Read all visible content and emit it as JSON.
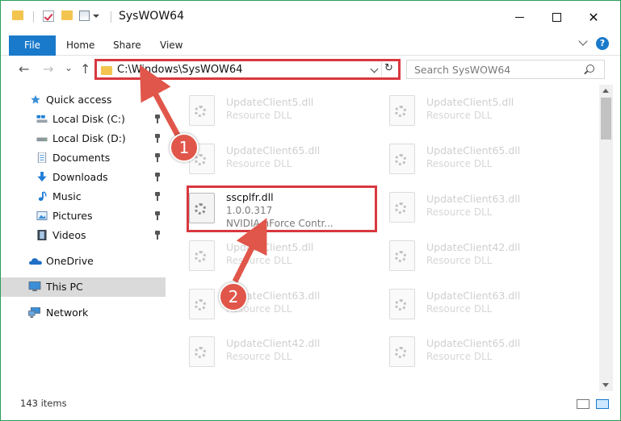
{
  "window": {
    "title": "SysWOW64",
    "controls": {
      "minimize": "",
      "maximize": "",
      "close": "✕"
    }
  },
  "ribbon": {
    "tabs": [
      "File",
      "Home",
      "Share",
      "View"
    ],
    "help": "?"
  },
  "address": {
    "path": "C:\\Windows\\SysWOW64",
    "refresh": "↻"
  },
  "search": {
    "placeholder": "Search SysWOW64"
  },
  "nav": {
    "back": "←",
    "forward": "→",
    "recent": "⌄",
    "up": "↑"
  },
  "sidebar": {
    "items": [
      {
        "label": "Quick access"
      },
      {
        "label": "Local Disk (C:)"
      },
      {
        "label": "Local Disk (D:)"
      },
      {
        "label": "Documents"
      },
      {
        "label": "Downloads"
      },
      {
        "label": "Music"
      },
      {
        "label": "Pictures"
      },
      {
        "label": "Videos"
      },
      {
        "label": "OneDrive"
      },
      {
        "label": "This PC"
      },
      {
        "label": "Network"
      }
    ]
  },
  "files": {
    "left": [
      {
        "name": "UpdateClient5.dll",
        "desc": "Resource DLL"
      },
      {
        "name": "UpdateClient65.dll",
        "desc": "Resource DLL"
      },
      {
        "name": "ssсplfr.dll",
        "version": "1.0.0.317",
        "desc": "NVIDIA nForce Contr..."
      },
      {
        "name": "UpdateClient5.dll",
        "desc": "Resource DLL"
      },
      {
        "name": "UpdateClient63.dll",
        "desc": "Resource DLL"
      },
      {
        "name": "UpdateClient42.dll",
        "desc": "Resource DLL"
      }
    ],
    "right": [
      {
        "name": "UpdateClient5.dll",
        "desc": "Resource DLL"
      },
      {
        "name": "UpdateClient65.dll",
        "desc": "Resource DLL"
      },
      {
        "name": "UpdateClient63.dll",
        "desc": "Resource DLL"
      },
      {
        "name": "UpdateClient42.dll",
        "desc": "Resource DLL"
      },
      {
        "name": "UpdateClient63.dll",
        "desc": "Resource DLL"
      },
      {
        "name": "UpdateClient65.dll",
        "desc": "Resource DLL"
      }
    ]
  },
  "status": {
    "count": "143 items"
  },
  "annotations": {
    "step1": "1",
    "step2": "2",
    "color": "#d9383f"
  },
  "colors": {
    "accent": "#1979ca",
    "highlight": "#d9383f",
    "folder": "#f3c550"
  }
}
